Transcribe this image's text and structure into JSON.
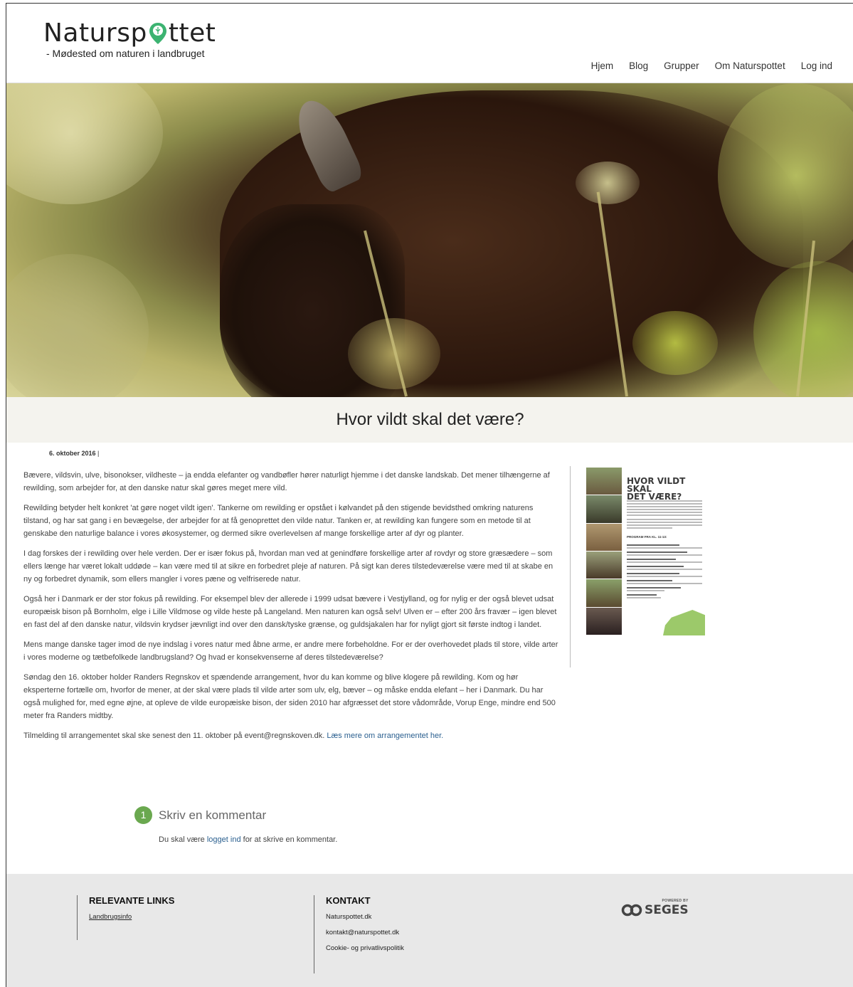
{
  "header": {
    "logo_part1": "Natursp",
    "logo_part2": "ttet",
    "tagline": "- Mødested om naturen i landbruget",
    "nav": [
      "Hjem",
      "Blog",
      "Grupper",
      "Om Naturspottet",
      "Log ind"
    ]
  },
  "article": {
    "title": "Hvor vildt skal det være?",
    "date": "6. oktober 2016",
    "date_sep": "|",
    "paragraphs": [
      "Bævere, vildsvin, ulve, bisonokser, vildheste – ja endda elefanter og vandbøfler hører naturligt hjemme i det danske landskab. Det mener tilhængerne af rewilding, som arbejder for, at den  danske natur skal gøres meget mere vild.",
      "Rewilding betyder helt konkret 'at gøre noget vildt igen'. Tankerne om rewilding er opstået i kølvandet på den stigende bevidsthed omkring naturens tilstand, og har sat gang i  en bevægelse, der arbejder for at få genoprettet den vilde natur. Tanken er, at rewilding kan fungere som en metode til at genskabe den naturlige balance i vores økosystemer, og dermed sikre overlevelsen af mange forskellige arter af dyr og planter.",
      "I dag forskes der i rewilding over hele verden.  Der er især fokus på, hvordan man ved at genindføre forskellige arter af rovdyr og store græsædere – som ellers længe har været lokalt uddøde – kan være med til at sikre en forbedret pleje af naturen. På sigt kan deres tilstedeværelse være med til at skabe en ny og forbedret dynamik, som ellers mangler i vores pæne og velfriserede natur.",
      "Også her i Danmark er der stor fokus på rewilding. For eksempel blev der allerede i 1999 udsat bævere i Vestjylland, og for nylig er der også blevet udsat europæisk bison på Bornholm, elge i Lille Vildmose og vilde heste på Langeland. Men naturen kan også selv! Ulven er – efter 200 års fravær – igen blevet en fast del af den danske natur, vildsvin krydser jævnligt ind over den dansk/tyske grænse, og guldsjakalen har for nyligt gjort sit første indtog i landet.",
      "Mens mange danske tager imod de nye indslag i vores natur med åbne arme, er andre mere forbeholdne. For er der overhovedet plads til store, vilde arter i vores moderne og tætbefolkede landbrugsland? Og hvad er konsekvenserne af deres tilstedeværelse?",
      "Søndag den 16. oktober holder Randers Regnskov et spændende arrangement, hvor du kan komme og blive klogere  på rewilding. Kom og hør eksperterne fortælle om, hvorfor de mener, at der skal være plads til vilde arter som ulv, elg, bæver – og måske endda elefant – her i Danmark. Du har også mulighed for, med egne øjne, at opleve de vilde europæiske bison, der siden 2010 har afgræsset det store vådområde, Vorup Enge, mindre end 500 meter fra Randers midtby."
    ],
    "last_paragraph_text": "Tilmelding til arrangementet skal ske senest den 11. oktober på event@regnskoven.dk. ",
    "last_paragraph_link": "Læs mere om arrangementet her."
  },
  "poster": {
    "title_line1": "HVOR VILDT SKAL",
    "title_line2": "DET VÆRE?",
    "program_heading": "PROGRAM FRA KL. 11-13:"
  },
  "comments": {
    "count": "1",
    "heading": "Skriv en kommentar",
    "note_before": "Du skal være ",
    "note_link": "logget ind",
    "note_after": " for at skrive en kommentar."
  },
  "footer": {
    "links_heading": "RELEVANTE LINKS",
    "links": [
      "Landbrugsinfo"
    ],
    "contact_heading": "KONTAKT",
    "contact_items": [
      "Naturspottet.dk",
      "kontakt@naturspottet.dk",
      "Cookie- og privatlivspolitik"
    ],
    "powered_by": "POWERED BY",
    "brand": "SEGES"
  },
  "colors": {
    "accent_green": "#6aa84f",
    "link_blue": "#2a5f8f",
    "footer_bg": "#e8e8e8",
    "title_band_bg": "#f4f3ee"
  }
}
